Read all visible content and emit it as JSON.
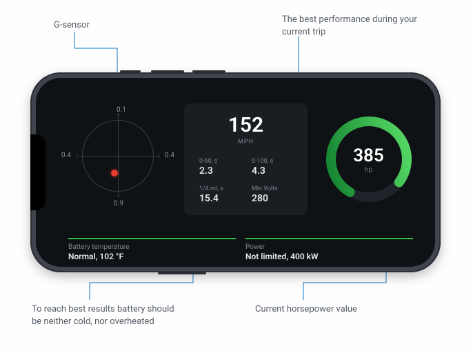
{
  "annotations": {
    "gsensor": "G-sensor",
    "performance": "The best performance during your current trip",
    "battery": "To reach best results battery should be neither cold, nor overheated",
    "horsepower": "Current horsepower value"
  },
  "gsensor": {
    "top": "0.1",
    "left": "0.4",
    "right": "0.4",
    "bottom": "0.9"
  },
  "performance": {
    "speed_value": "152",
    "speed_unit": "MPH",
    "stats": {
      "s0_60_label": "0-60, s",
      "s0_60_value": "2.3",
      "s0_100_label": "0-100, s",
      "s0_100_value": "4.3",
      "qmile_label": "1/4 mi, s",
      "qmile_value": "15.4",
      "minvolts_label": "Min Volts",
      "minvolts_value": "280"
    }
  },
  "hp": {
    "value": "385",
    "unit": "hp"
  },
  "status": {
    "battery_label": "Battery temperature",
    "battery_value": "Normal, 102 °F",
    "power_label": "Power",
    "power_value": "Not limited, 400 kW"
  },
  "colors": {
    "accent_green": "#2cbf3f",
    "gauge_green_light": "#4dd35a",
    "gauge_green_dark": "#0e7a2c",
    "gsensor_dot": "#e63b2e",
    "callout": "#0b74c6"
  },
  "chart_data": {
    "type": "gauge",
    "title": "Horsepower",
    "value": 385,
    "unit": "hp",
    "range": [
      0,
      500
    ],
    "fill_fraction": 0.77
  }
}
